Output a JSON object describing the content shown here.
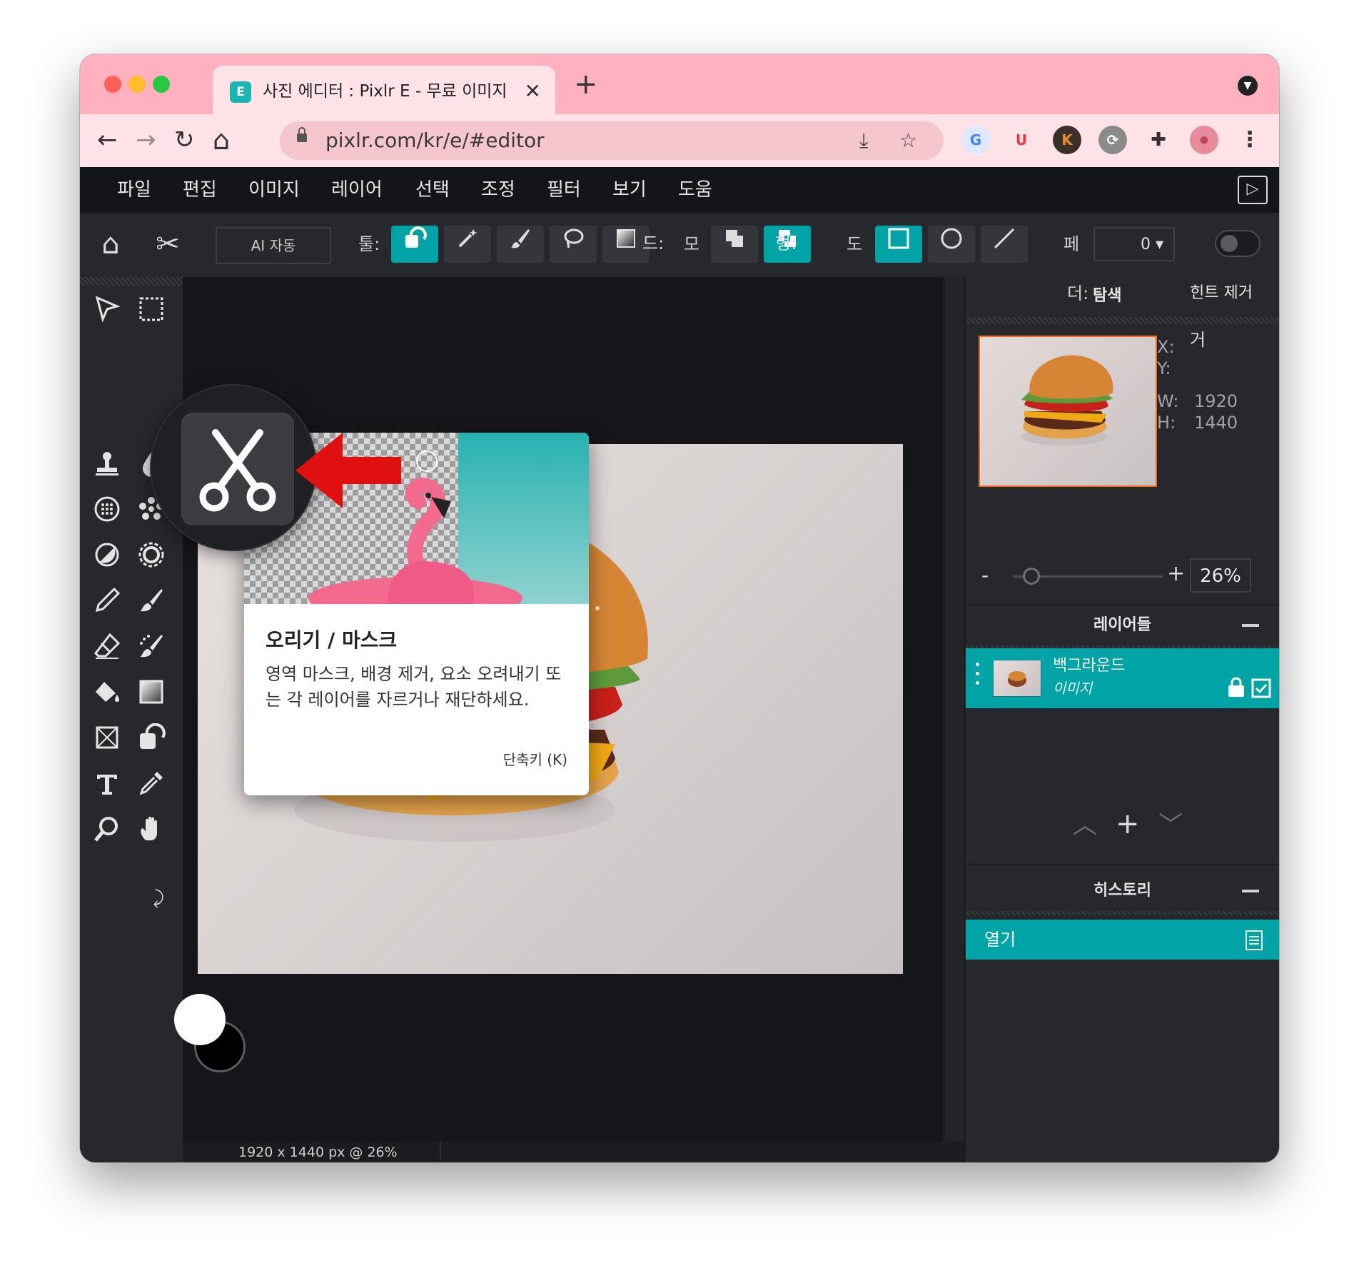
{
  "browser": {
    "tab_title": "사진 에디터 : Pixlr E - 무료 이미지 편",
    "tab_favicon": "E",
    "tab_close": "✕",
    "new_tab": "+",
    "url": "pixlr.com/kr/e/#editor",
    "nav": {
      "back": "←",
      "forward": "→",
      "reload": "↻",
      "home": "⌂"
    },
    "omni_icons": {
      "install": "⤓",
      "bookmark": "☆"
    },
    "extensions": [
      "G",
      "U",
      "K",
      "⟳",
      "✚",
      "●"
    ],
    "menu": "⋮",
    "colors": {
      "chrome": "#ffb1bf",
      "toolbar": "#ffe3e9"
    }
  },
  "menubar": {
    "items": [
      "파일",
      "편집",
      "이미지",
      "레이어",
      "선택",
      "조정",
      "필터",
      "보기",
      "도움"
    ],
    "panel_toggle": "▷"
  },
  "options": {
    "home_icon": "⌂",
    "cutout_icon": "✂",
    "ai_auto": "AI 자동",
    "tool_label": "툴:",
    "mode_label": "모",
    "mode_label_2": "드:",
    "shape_label": "도",
    "shape_label_2": "형:",
    "feather_label": "페",
    "feather_value": "0 ▾"
  },
  "tools_tooltip": {
    "title": "오리기 / 마스크",
    "description": "영역 마스크, 배경 제거, 요소 오려내기 또는 각 레이어를 자르거나 재단하세요.",
    "shortcut": "단축키 (K)"
  },
  "status": {
    "text": "1920 x 1440 px @ 26%"
  },
  "navigator": {
    "title_prefix": "더:",
    "title": "탐색",
    "hint": "힌트 제거",
    "x_label": "X:",
    "y_label": "Y:",
    "w_label": "W:",
    "w_value": "1920",
    "h_label": "H:",
    "h_value": "1440",
    "zoom_minus": "-",
    "zoom_plus": "+",
    "zoom_value": "26%",
    "zoom_level": 0.26
  },
  "layers": {
    "title": "레이어들",
    "items": [
      {
        "name": "백그라운드",
        "type": "이미지"
      }
    ],
    "controls": {
      "up": "︿",
      "add": "+",
      "down": "﹀"
    }
  },
  "history": {
    "title": "히스토리",
    "items": [
      "열기"
    ]
  },
  "accent": "#00a4a6"
}
